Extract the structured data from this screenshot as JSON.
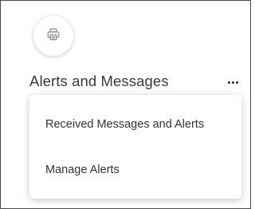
{
  "print_button": {
    "icon": "printer-icon"
  },
  "section": {
    "title": "Alerts and Messages",
    "more_icon": "more-horizontal-icon"
  },
  "menu": {
    "items": [
      {
        "label": "Received Messages and Alerts"
      },
      {
        "label": "Manage Alerts"
      }
    ]
  }
}
